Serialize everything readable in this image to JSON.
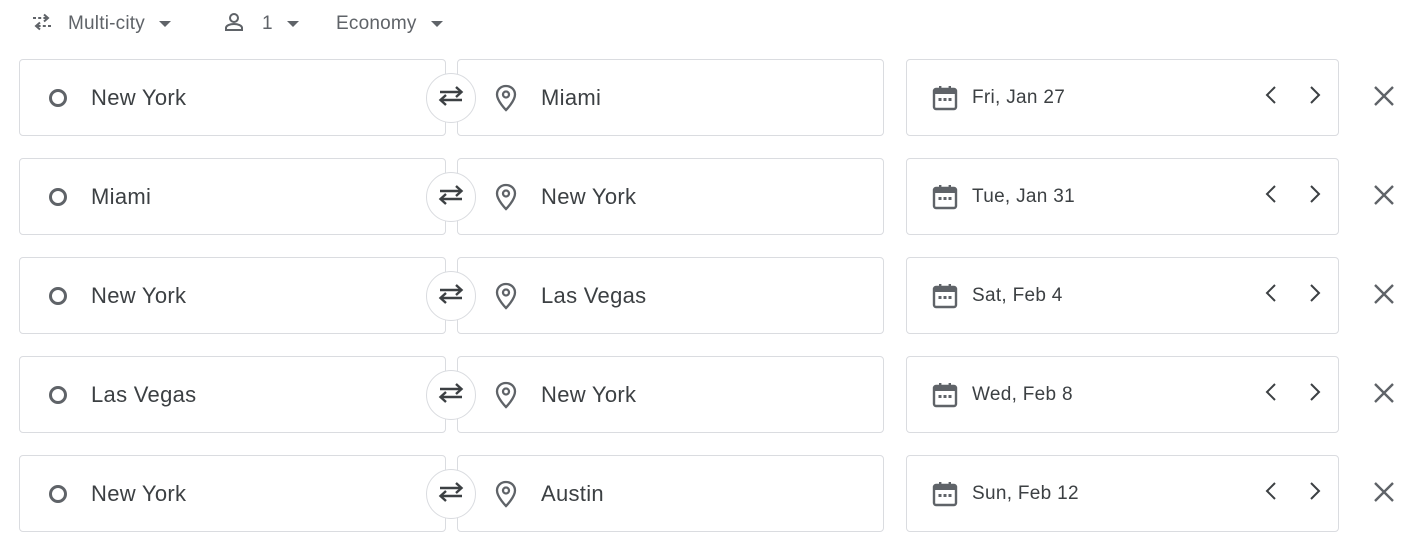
{
  "toolbar": {
    "trip_type": {
      "label": "Multi-city",
      "icon": "swap-dotted-icon"
    },
    "passengers": {
      "count": "1",
      "icon": "person-icon"
    },
    "cabin_class": {
      "label": "Economy"
    }
  },
  "legs": [
    {
      "origin": "New York",
      "destination": "Miami",
      "date": "Fri, Jan 27"
    },
    {
      "origin": "Miami",
      "destination": "New York",
      "date": "Tue, Jan 31"
    },
    {
      "origin": "New York",
      "destination": "Las Vegas",
      "date": "Sat, Feb 4"
    },
    {
      "origin": "Las Vegas",
      "destination": "New York",
      "date": "Wed, Feb 8"
    },
    {
      "origin": "New York",
      "destination": "Austin",
      "date": "Sun, Feb 12"
    }
  ],
  "colors": {
    "icon_gray": "#5f6368",
    "text": "#3c4043",
    "border": "#dadce0"
  }
}
